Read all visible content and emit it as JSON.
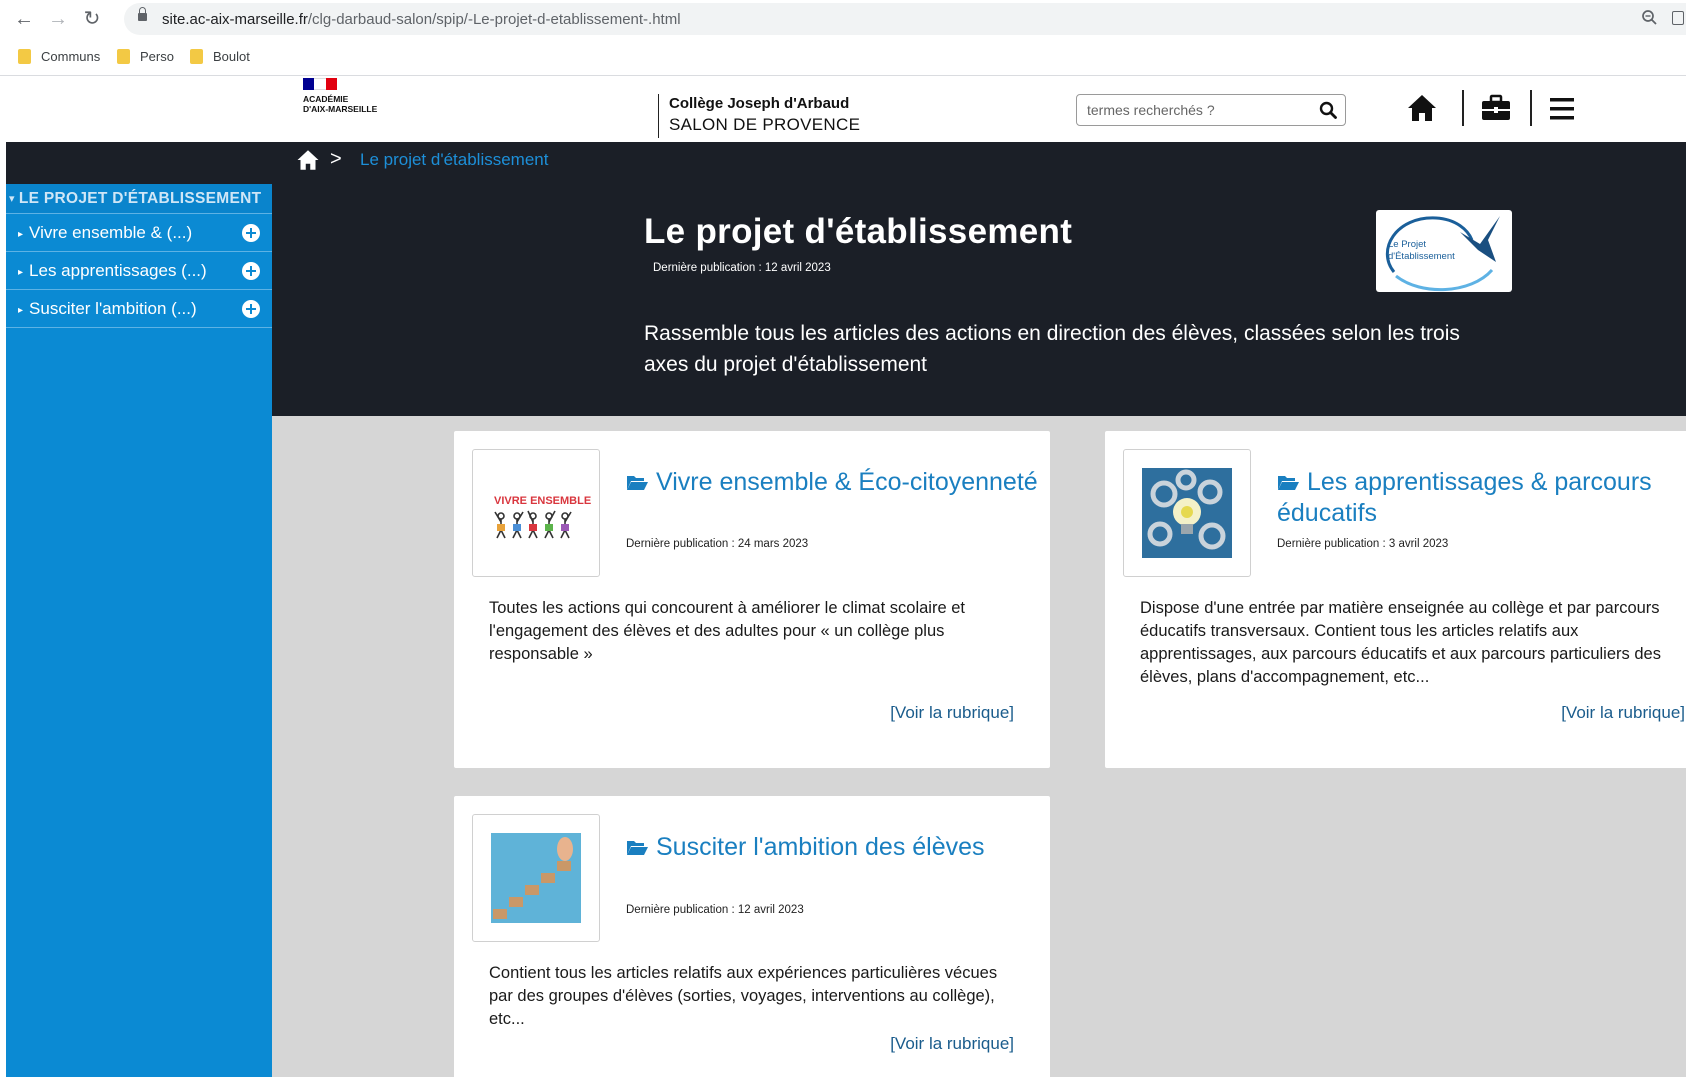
{
  "browser": {
    "back_label": "←",
    "forward_label": "→",
    "reload_label": "↻",
    "url_domain": "site.ac-aix-marseille.fr",
    "url_path": "/clg-darbaud-salon/spip/-Le-projet-d-etablissement-.html",
    "bookmarks": [
      "Communs",
      "Perso",
      "Boulot"
    ]
  },
  "header": {
    "academy_text": "ACADÉMIE\nD'AIX-MARSEILLE",
    "college_name": "Collège Joseph d'Arbaud",
    "college_city": "SALON DE PROVENCE",
    "search_placeholder": "termes recherchés ?",
    "icons": [
      "home-icon",
      "briefcase-icon",
      "menu-icon"
    ]
  },
  "breadcrumb": {
    "separator": ">",
    "current": "Le projet d'établissement"
  },
  "sidebar": {
    "heading": "LE PROJET D'ÉTABLISSEMENT",
    "heading_marker": "▾",
    "items": [
      {
        "label": "Vivre ensemble & (...)",
        "marker": "▸"
      },
      {
        "label": "Les apprentissages (...)",
        "marker": "▸"
      },
      {
        "label": "Susciter l'ambition (...)",
        "marker": "▸"
      }
    ]
  },
  "hero": {
    "title": "Le projet d'établissement",
    "date": "Dernière publication : 12 avril 2023",
    "description": "Rassemble tous les articles des actions en direction des élèves, classées selon les trois axes du projet d'établissement",
    "logo_text_1": "Le Projet",
    "logo_text_2": "d'Établissement"
  },
  "cards": [
    {
      "title": "Vivre ensemble & Éco-citoyenneté",
      "date": "Dernière publication : 24 mars 2023",
      "description": "Toutes les actions qui concourent à améliorer le climat scolaire et l'engagement des élèves et des adultes pour « un collège plus responsable »",
      "link": "[Voir la rubrique]",
      "thumb_text": "VIVRE ENSEMBLE"
    },
    {
      "title": "Les apprentissages & parcours éducatifs",
      "date": "Dernière publication : 3 avril 2023",
      "description": "Dispose d'une entrée par matière enseignée au collège et par parcours éducatifs transversaux. Contient tous les articles relatifs aux apprentissages, aux parcours éducatifs et aux parcours particuliers des élèves, plans d'accompagnement, etc...",
      "link": "[Voir la rubrique]"
    },
    {
      "title": "Susciter l'ambition des élèves",
      "date": "Dernière publication : 12 avril 2023",
      "description": "Contient tous les articles relatifs aux expériences particulières vécues par des groupes d'élèves (sorties, voyages, interventions au collège), etc...",
      "link": "[Voir la rubrique]"
    }
  ],
  "colors": {
    "sidebar_blue": "#0b8ad3",
    "hero_dark": "#1b1f27",
    "title_blue": "#1a7fc0",
    "grey_bg": "#d6d6d6"
  }
}
